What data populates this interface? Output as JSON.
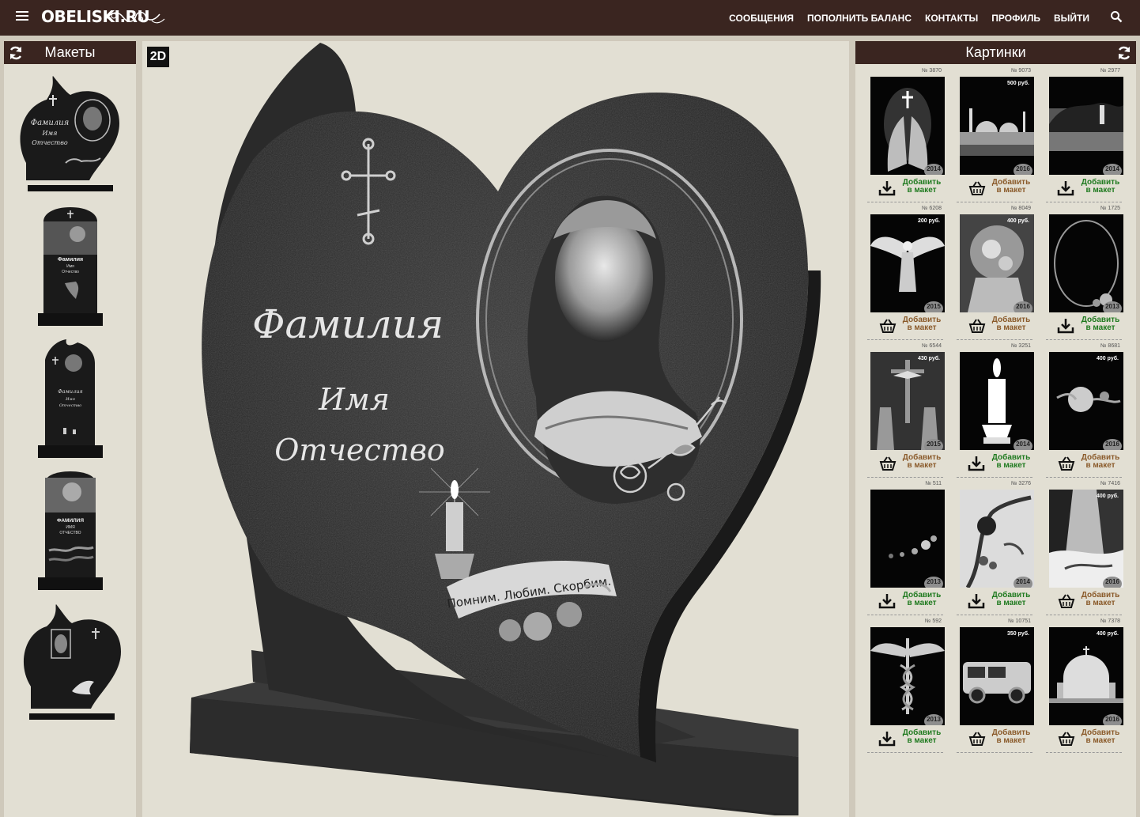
{
  "header": {
    "logo": "OBELISKI.RU",
    "nav": [
      "СООБЩЕНИЯ",
      "ПОПОЛНИТЬ БАЛАНС",
      "КОНТАКТЫ",
      "ПРОФИЛЬ",
      "ВЫЙТИ"
    ]
  },
  "left_panel": {
    "title": "Макеты",
    "mini_texts": {
      "m1": [
        "Фамилия",
        "Имя",
        "Отчество"
      ],
      "m2": [
        "Фамилия",
        "Имя",
        "Отчество"
      ],
      "m3": [
        "Фамилия",
        "Имя",
        "Отчество"
      ],
      "m4": [
        "ФАМИЛИЯ",
        "ИМЯ",
        "ОТЧЕСТВО"
      ]
    }
  },
  "main": {
    "mode_button": "2D",
    "surname": "Фамилия",
    "name": "Имя",
    "patronymic": "Отчество",
    "ribbon": "Помним. Любим. Скорбим."
  },
  "right_panel": {
    "title": "Картинки",
    "items": [
      {
        "num": "№ 3870",
        "price": "",
        "year": "2014",
        "action": "download",
        "label1": "Добавить",
        "label2": "в макет",
        "motif": "hands"
      },
      {
        "num": "№ 9073",
        "price": "500 руб.",
        "year": "2016",
        "action": "basket",
        "label1": "Добавить",
        "label2": "в макет",
        "motif": "mosque"
      },
      {
        "num": "№ 2977",
        "price": "",
        "year": "2014",
        "action": "download",
        "label1": "Добавить",
        "label2": "в макет",
        "motif": "lake"
      },
      {
        "num": "№ 6208",
        "price": "200 руб.",
        "year": "2015",
        "action": "basket",
        "label1": "Добавить",
        "label2": "в макет",
        "motif": "angel"
      },
      {
        "num": "№ 8049",
        "price": "400 руб.",
        "year": "2016",
        "action": "basket",
        "label1": "Добавить",
        "label2": "в макет",
        "motif": "icon"
      },
      {
        "num": "№ 1725",
        "price": "",
        "year": "2013",
        "action": "download",
        "label1": "Добавить",
        "label2": "в макет",
        "motif": "oval"
      },
      {
        "num": "№ 6544",
        "price": "430 руб.",
        "year": "2015",
        "action": "basket",
        "label1": "Добавить",
        "label2": "в макет",
        "motif": "crucifix"
      },
      {
        "num": "№ 3251",
        "price": "",
        "year": "2014",
        "action": "download",
        "label1": "Добавить",
        "label2": "в макет",
        "motif": "candle"
      },
      {
        "num": "№ 8681",
        "price": "400 руб.",
        "year": "2016",
        "action": "basket",
        "label1": "Добавить",
        "label2": "в макет",
        "motif": "rose"
      },
      {
        "num": "№ 511",
        "price": "",
        "year": "2013",
        "action": "download",
        "label1": "Добавить",
        "label2": "в макет",
        "motif": "flowers"
      },
      {
        "num": "№ 3276",
        "price": "",
        "year": "2014",
        "action": "download",
        "label1": "Добавить",
        "label2": "в макет",
        "motif": "bird"
      },
      {
        "num": "№ 7416",
        "price": "400 руб.",
        "year": "2016",
        "action": "basket",
        "label1": "Добавить",
        "label2": "в макет",
        "motif": "forest"
      },
      {
        "num": "№ 592",
        "price": "",
        "year": "2013",
        "action": "download",
        "label1": "Добавить",
        "label2": "в макет",
        "motif": "caduceus"
      },
      {
        "num": "№ 10751",
        "price": "350 руб.",
        "year": "",
        "action": "basket",
        "label1": "Добавить",
        "label2": "в макет",
        "motif": "van"
      },
      {
        "num": "№ 7378",
        "price": "400 руб.",
        "year": "2016",
        "action": "basket",
        "label1": "Добавить",
        "label2": "в макет",
        "motif": "church"
      }
    ]
  },
  "colors": {
    "header_bg": "#3a2520",
    "panel_bg": "#e2dfd3",
    "granite": "#2a2a2a",
    "add_free": "#1f7a1f",
    "add_paid": "#8a5a2a"
  }
}
